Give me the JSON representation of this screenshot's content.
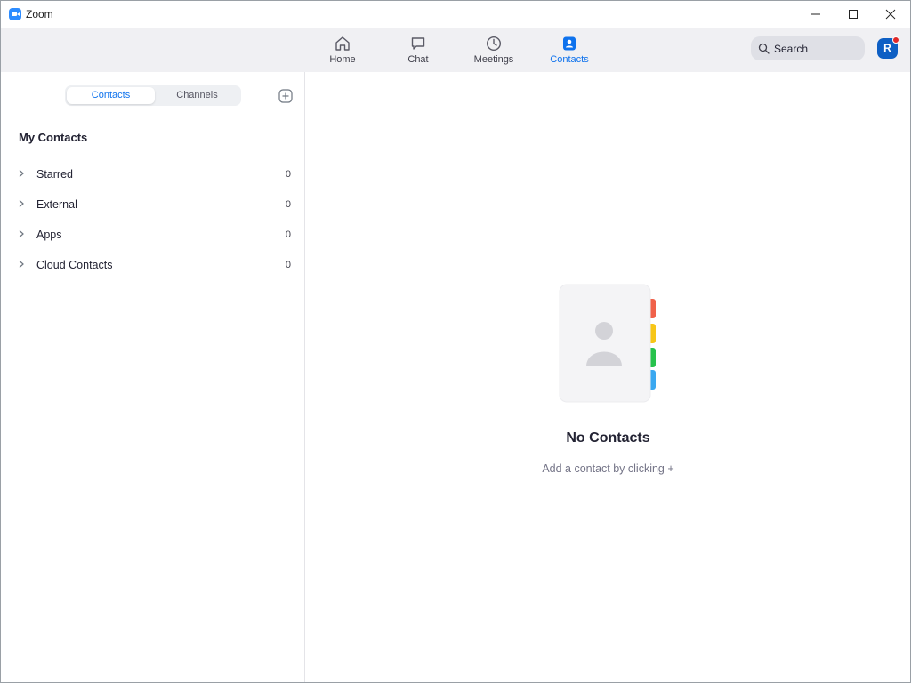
{
  "window": {
    "title": "Zoom"
  },
  "nav": {
    "tabs": [
      {
        "label": "Home",
        "icon": "home-icon"
      },
      {
        "label": "Chat",
        "icon": "chat-icon"
      },
      {
        "label": "Meetings",
        "icon": "clock-icon"
      },
      {
        "label": "Contacts",
        "icon": "contacts-icon",
        "active": true
      }
    ],
    "search_label": "Search",
    "avatar_initial": "R"
  },
  "sidebar": {
    "segments": [
      "Contacts",
      "Channels"
    ],
    "selected_segment": "Contacts",
    "section_title": "My Contacts",
    "groups": [
      {
        "label": "Starred",
        "count": "0"
      },
      {
        "label": "External",
        "count": "0"
      },
      {
        "label": "Apps",
        "count": "0"
      },
      {
        "label": "Cloud Contacts",
        "count": "0"
      }
    ]
  },
  "main": {
    "empty_title": "No Contacts",
    "empty_subtitle": "Add a contact by clicking +"
  },
  "colors": {
    "accent": "#0e72ed",
    "brand": "#2d8cff",
    "tab_red": "#f0614a",
    "tab_yellow": "#f7c617",
    "tab_green": "#27c24c",
    "tab_blue": "#3aa8f0"
  }
}
